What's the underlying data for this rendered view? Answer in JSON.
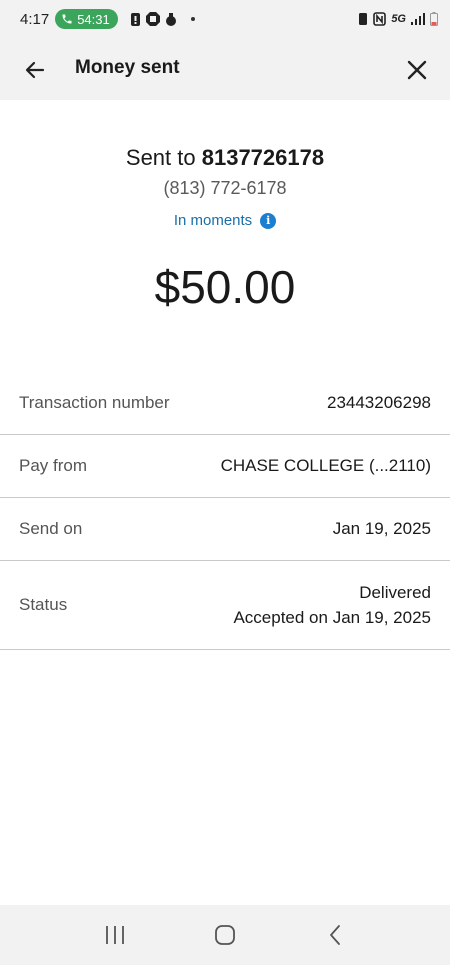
{
  "status_bar": {
    "time": "4:17",
    "call_timer": "54:31",
    "network": "5G"
  },
  "header": {
    "title": "Money sent"
  },
  "summary": {
    "sent_to_prefix": "Sent to",
    "recipient": "8137726178",
    "phone": "(813) 772-6178",
    "timing": "In moments",
    "amount": "$50.00"
  },
  "details": [
    {
      "label": "Transaction number",
      "value": "23443206298"
    },
    {
      "label": "Pay from",
      "value": "CHASE COLLEGE (...2110)"
    },
    {
      "label": "Send on",
      "value": "Jan 19, 2025"
    },
    {
      "label": "Status",
      "value": "Delivered",
      "subvalue": "Accepted on Jan 19, 2025"
    }
  ],
  "colors": {
    "accent": "#1a6fa8",
    "info_icon": "#1a7fd0",
    "call_pill": "#3ba55c"
  }
}
